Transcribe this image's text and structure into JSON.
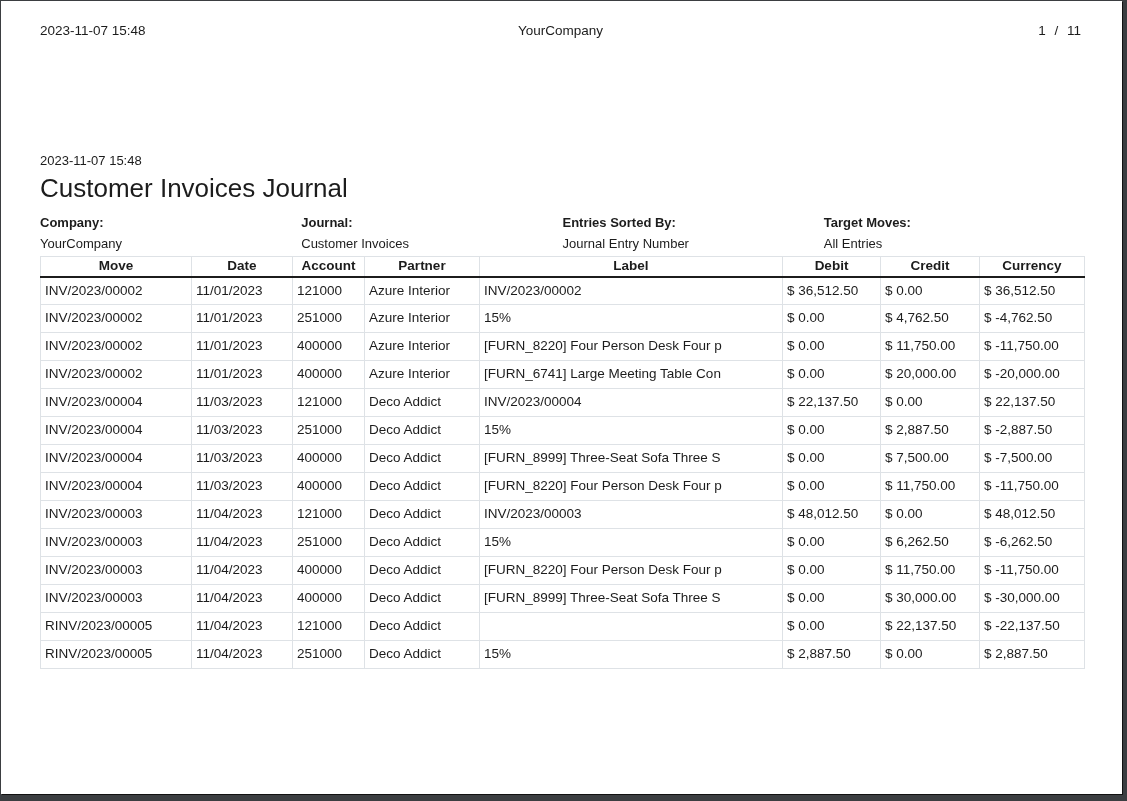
{
  "page_header": {
    "printed_at": "2023-11-07 15:48",
    "company": "YourCompany",
    "page_indicator": "1 / 11"
  },
  "report": {
    "printed_at": "2023-11-07 15:48",
    "title": "Customer Invoices Journal",
    "filters": [
      {
        "label": "Company:",
        "value": "YourCompany"
      },
      {
        "label": "Journal:",
        "value": "Customer Invoices"
      },
      {
        "label": "Entries Sorted By:",
        "value": "Journal Entry Number"
      },
      {
        "label": "Target Moves:",
        "value": "All Entries"
      }
    ]
  },
  "table": {
    "columns": [
      "Move",
      "Date",
      "Account",
      "Partner",
      "Label",
      "Debit",
      "Credit",
      "Currency"
    ],
    "rows": [
      {
        "move": "INV/2023/00002",
        "date": "11/01/2023",
        "account": "121000",
        "partner": "Azure Interior",
        "label": "INV/2023/00002",
        "debit": "$ 36,512.50",
        "credit": "$ 0.00",
        "currency": "$ 36,512.50"
      },
      {
        "move": "INV/2023/00002",
        "date": "11/01/2023",
        "account": "251000",
        "partner": "Azure Interior",
        "label": "15%",
        "debit": "$ 0.00",
        "credit": "$ 4,762.50",
        "currency": "$ -4,762.50"
      },
      {
        "move": "INV/2023/00002",
        "date": "11/01/2023",
        "account": "400000",
        "partner": "Azure Interior",
        "label": "[FURN_8220] Four Person Desk Four p",
        "debit": "$ 0.00",
        "credit": "$ 11,750.00",
        "currency": "$ -11,750.00"
      },
      {
        "move": "INV/2023/00002",
        "date": "11/01/2023",
        "account": "400000",
        "partner": "Azure Interior",
        "label": "[FURN_6741] Large Meeting Table Con",
        "debit": "$ 0.00",
        "credit": "$ 20,000.00",
        "currency": "$ -20,000.00"
      },
      {
        "move": "INV/2023/00004",
        "date": "11/03/2023",
        "account": "121000",
        "partner": "Deco Addict",
        "label": "INV/2023/00004",
        "debit": "$ 22,137.50",
        "credit": "$ 0.00",
        "currency": "$ 22,137.50"
      },
      {
        "move": "INV/2023/00004",
        "date": "11/03/2023",
        "account": "251000",
        "partner": "Deco Addict",
        "label": "15%",
        "debit": "$ 0.00",
        "credit": "$ 2,887.50",
        "currency": "$ -2,887.50"
      },
      {
        "move": "INV/2023/00004",
        "date": "11/03/2023",
        "account": "400000",
        "partner": "Deco Addict",
        "label": "[FURN_8999] Three-Seat Sofa Three S",
        "debit": "$ 0.00",
        "credit": "$ 7,500.00",
        "currency": "$ -7,500.00"
      },
      {
        "move": "INV/2023/00004",
        "date": "11/03/2023",
        "account": "400000",
        "partner": "Deco Addict",
        "label": "[FURN_8220] Four Person Desk Four p",
        "debit": "$ 0.00",
        "credit": "$ 11,750.00",
        "currency": "$ -11,750.00"
      },
      {
        "move": "INV/2023/00003",
        "date": "11/04/2023",
        "account": "121000",
        "partner": "Deco Addict",
        "label": "INV/2023/00003",
        "debit": "$ 48,012.50",
        "credit": "$ 0.00",
        "currency": "$ 48,012.50"
      },
      {
        "move": "INV/2023/00003",
        "date": "11/04/2023",
        "account": "251000",
        "partner": "Deco Addict",
        "label": "15%",
        "debit": "$ 0.00",
        "credit": "$ 6,262.50",
        "currency": "$ -6,262.50"
      },
      {
        "move": "INV/2023/00003",
        "date": "11/04/2023",
        "account": "400000",
        "partner": "Deco Addict",
        "label": "[FURN_8220] Four Person Desk Four p",
        "debit": "$ 0.00",
        "credit": "$ 11,750.00",
        "currency": "$ -11,750.00"
      },
      {
        "move": "INV/2023/00003",
        "date": "11/04/2023",
        "account": "400000",
        "partner": "Deco Addict",
        "label": "[FURN_8999] Three-Seat Sofa Three S",
        "debit": "$ 0.00",
        "credit": "$ 30,000.00",
        "currency": "$ -30,000.00"
      },
      {
        "move": "RINV/2023/00005",
        "date": "11/04/2023",
        "account": "121000",
        "partner": "Deco Addict",
        "debit": "$ 0.00",
        "credit": "$ 22,137.50",
        "currency": "$ -22,137.50"
      },
      {
        "move": "RINV/2023/00005",
        "date": "11/04/2023",
        "account": "251000",
        "partner": "Deco Addict",
        "label": "15%",
        "debit": "$ 2,887.50",
        "credit": "$ 0.00",
        "currency": "$ 2,887.50"
      }
    ]
  }
}
